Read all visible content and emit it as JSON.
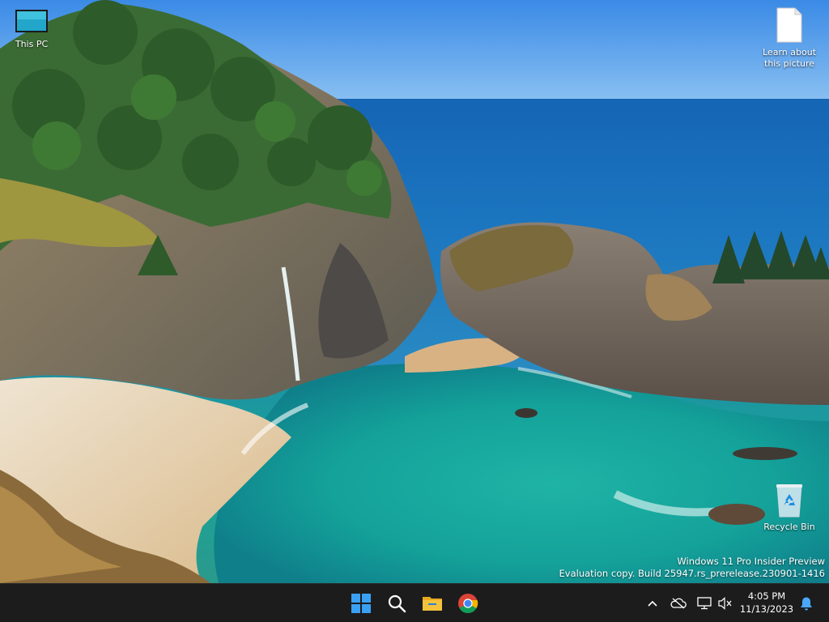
{
  "desktop": {
    "icons": [
      {
        "label": "This PC",
        "icon": "this-pc-icon"
      },
      {
        "label": "Learn about this picture",
        "icon": "document-icon"
      },
      {
        "label": "Recycle Bin",
        "icon": "recycle-bin-icon"
      }
    ],
    "watermark": {
      "line1": "Windows 11 Pro Insider Preview",
      "line2": "Evaluation copy. Build 25947.rs_prerelease.230901-1416"
    }
  },
  "taskbar": {
    "apps": [
      {
        "name": "Start",
        "icon": "windows-start-icon"
      },
      {
        "name": "Search",
        "icon": "search-icon"
      },
      {
        "name": "File Explorer",
        "icon": "folder-icon"
      },
      {
        "name": "Google Chrome",
        "icon": "chrome-icon"
      }
    ],
    "tray": {
      "icons": [
        "chevron-up-icon",
        "onedrive-icon",
        "network-icon",
        "volume-muted-icon",
        "notification-bell-icon"
      ],
      "time": "4:05 PM",
      "date": "11/13/2023"
    }
  },
  "colors": {
    "taskbar_bg": "#1c1c1c",
    "start_blue": "#3aa0f3",
    "folder_yellow": "#f5c33b",
    "notification_blue": "#4aa8ff"
  }
}
